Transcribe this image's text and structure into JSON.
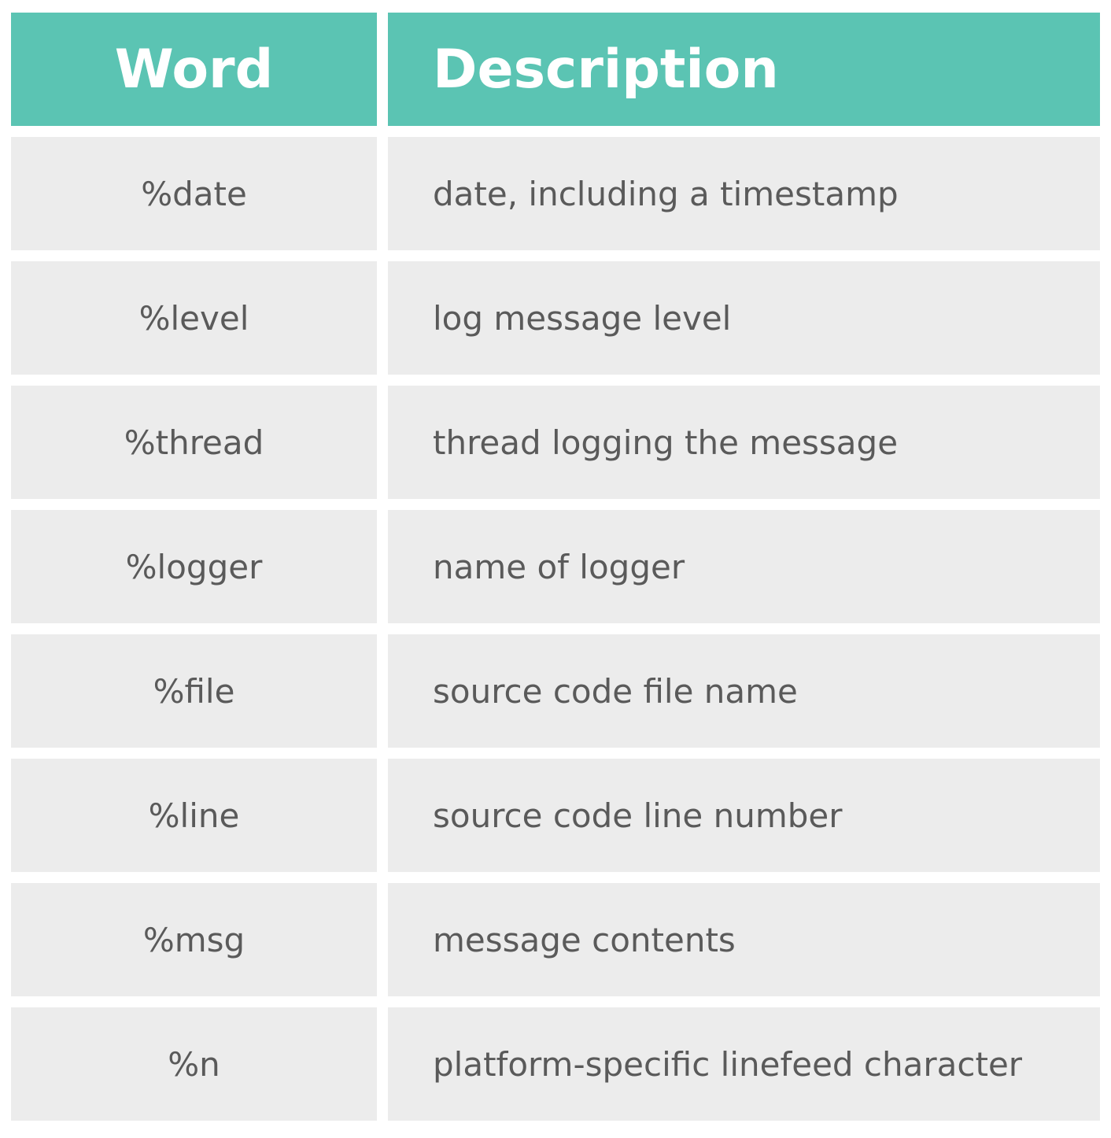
{
  "table": {
    "headers": [
      "Word",
      "Description"
    ],
    "rows": [
      {
        "word": "%date",
        "description": "date, including a timestamp"
      },
      {
        "word": "%level",
        "description": "log message level"
      },
      {
        "word": "%thread",
        "description": "thread logging the message"
      },
      {
        "word": "%logger",
        "description": "name of logger"
      },
      {
        "word": "%file",
        "description": "source code file name"
      },
      {
        "word": "%line",
        "description": "source code line number"
      },
      {
        "word": "%msg",
        "description": "message contents"
      },
      {
        "word": "%n",
        "description": "platform-specific linefeed character"
      }
    ]
  },
  "colors": {
    "header": "#5bc4b3",
    "row": "#ececec",
    "text": "#5a5a5a"
  }
}
